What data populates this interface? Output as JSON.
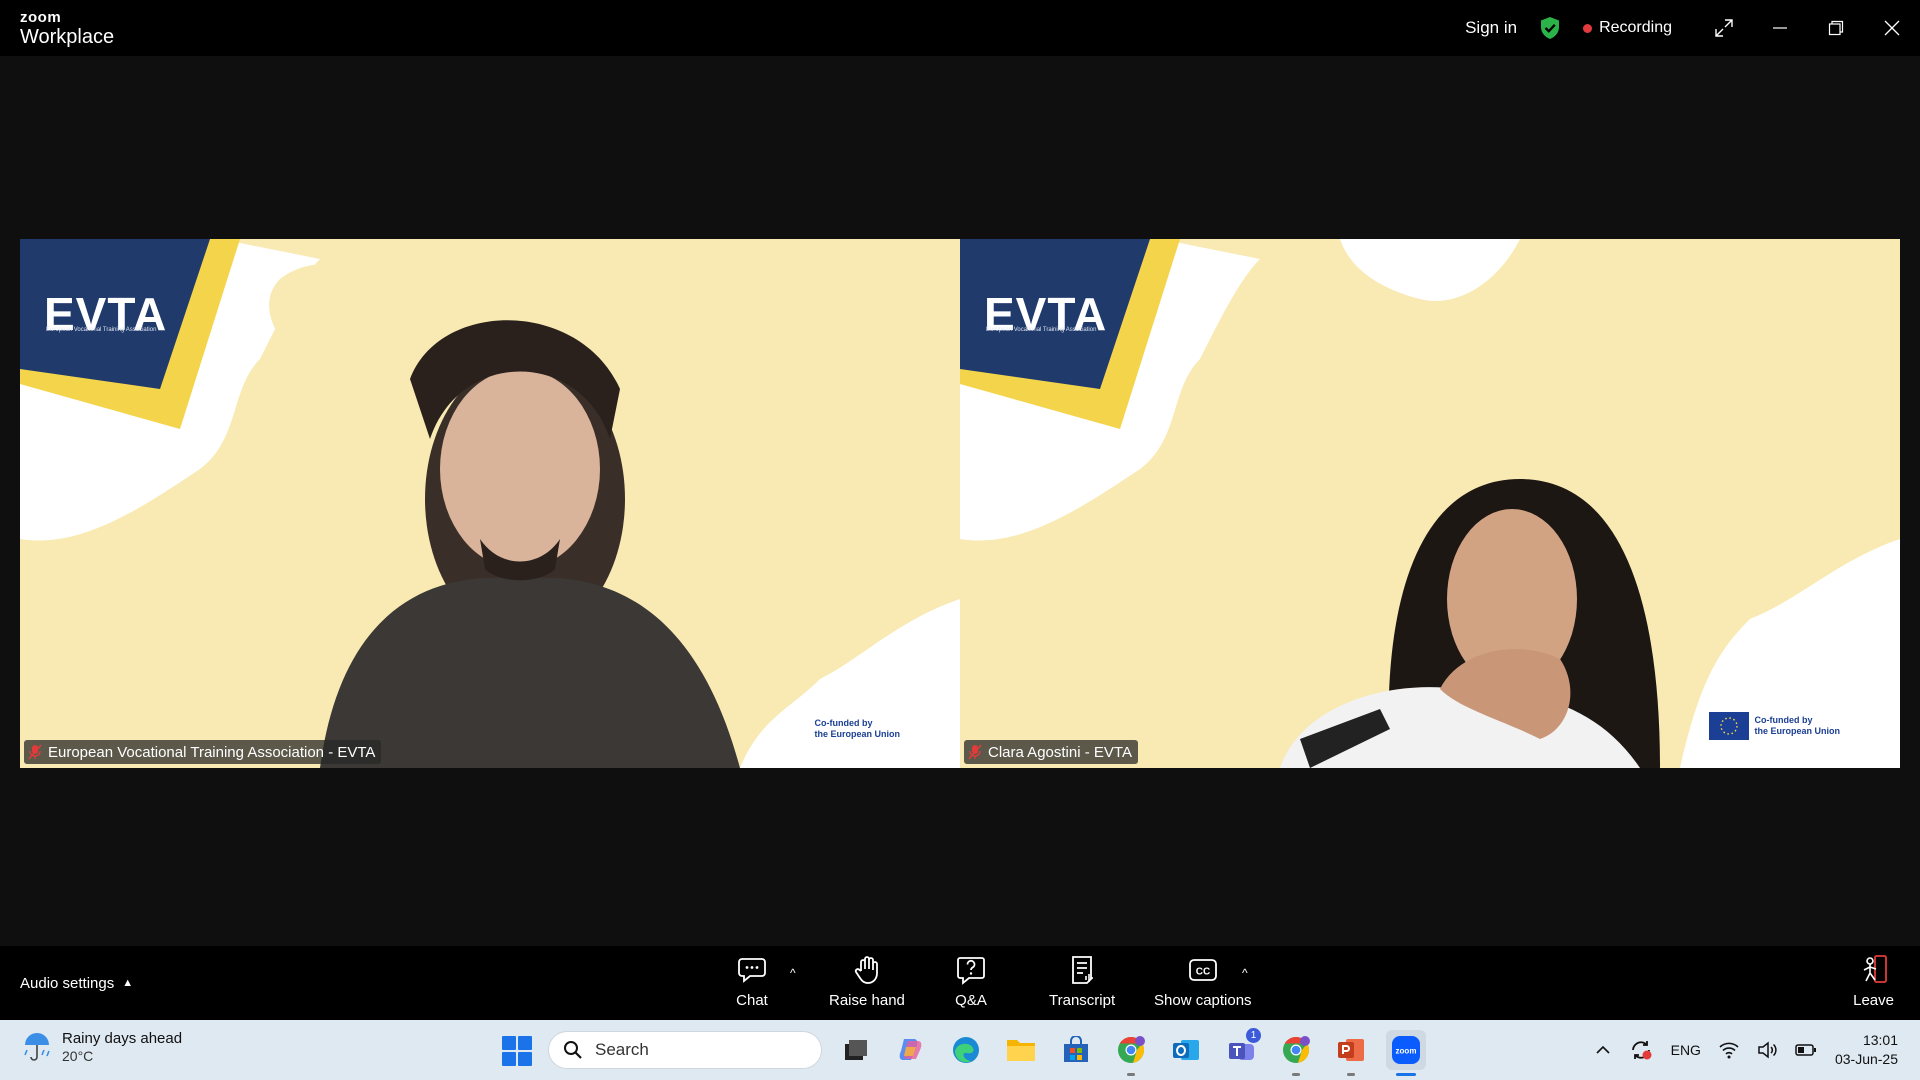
{
  "titlebar": {
    "brand_top": "zoom",
    "brand_bottom": "Workplace",
    "signin": "Sign in",
    "recording": "Recording",
    "shield_color": "#2bb34a",
    "recording_color": "#e23b3b"
  },
  "tiles": [
    {
      "name": "European Vocational Training Association - EVTA",
      "logo": "EVTA",
      "logo_sub": "European Vocational Training Association",
      "cofund_1": "Co-funded by",
      "cofund_2": "the European Union"
    },
    {
      "name": "Clara Agostini - EVTA",
      "logo": "EVTA",
      "logo_sub": "European Vocational Training Association",
      "cofund_1": "Co-funded by",
      "cofund_2": "the European Union"
    }
  ],
  "controls": {
    "audio_settings": "Audio settings",
    "chat": "Chat",
    "raise_hand": "Raise hand",
    "qa": "Q&A",
    "transcript": "Transcript",
    "show_captions": "Show captions",
    "leave": "Leave"
  },
  "taskbar": {
    "weather_title": "Rainy days ahead",
    "weather_temp": "20°C",
    "search_placeholder": "Search",
    "teams_badge": "1",
    "language": "ENG",
    "time": "13:01",
    "date": "03-Jun-25"
  }
}
